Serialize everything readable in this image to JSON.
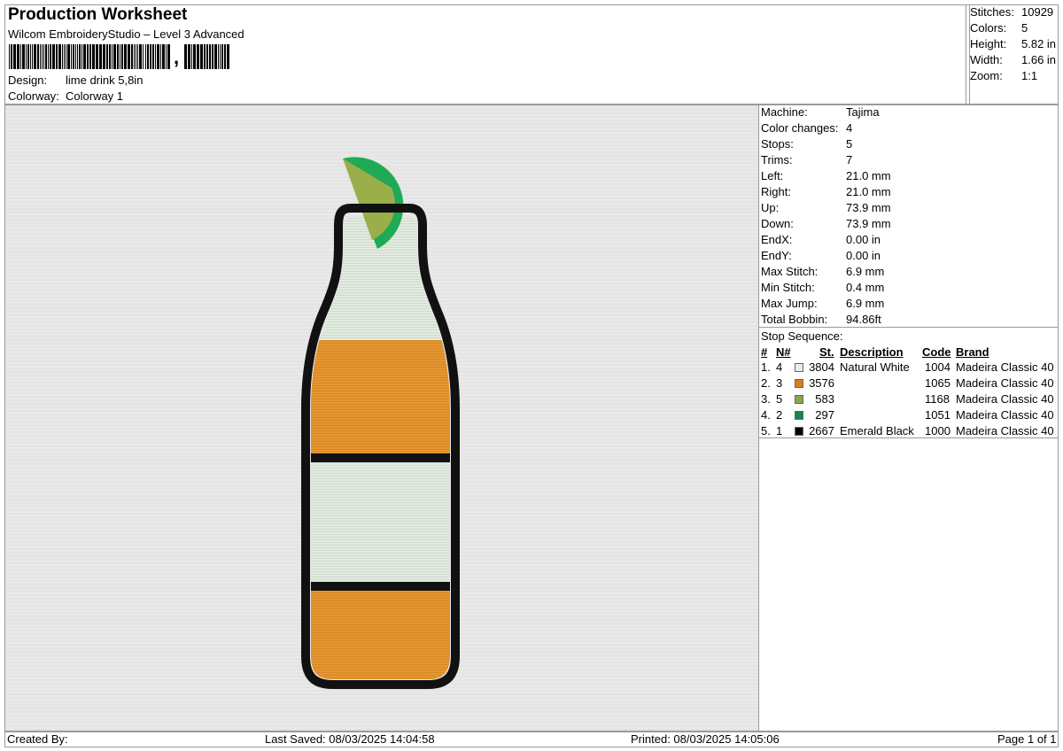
{
  "header": {
    "title": "Production Worksheet",
    "subtitle": "Wilcom EmbroideryStudio – Level 3 Advanced",
    "barcode_suffix": ",",
    "design_label": "Design:",
    "design_value": "lime drink 5,8in",
    "colorway_label": "Colorway:",
    "colorway_value": "Colorway 1"
  },
  "summary": [
    {
      "label": "Stitches:",
      "value": "10929"
    },
    {
      "label": "Colors:",
      "value": "5"
    },
    {
      "label": "Height:",
      "value": "5.82 in"
    },
    {
      "label": "Width:",
      "value": "1.66 in"
    },
    {
      "label": "Zoom:",
      "value": "1:1"
    }
  ],
  "info": [
    {
      "label": "Machine:",
      "value": "Tajima"
    },
    {
      "label": "Color changes:",
      "value": "4"
    },
    {
      "label": "Stops:",
      "value": "5"
    },
    {
      "label": "Trims:",
      "value": "7"
    },
    {
      "label": "Left:",
      "value": "21.0 mm"
    },
    {
      "label": "Right:",
      "value": "21.0 mm"
    },
    {
      "label": "Up:",
      "value": "73.9 mm"
    },
    {
      "label": "Down:",
      "value": "73.9 mm"
    },
    {
      "label": "EndX:",
      "value": "0.00 in"
    },
    {
      "label": "EndY:",
      "value": "0.00 in"
    },
    {
      "label": "Max Stitch:",
      "value": "6.9 mm"
    },
    {
      "label": "Min Stitch:",
      "value": "0.4 mm"
    },
    {
      "label": "Max Jump:",
      "value": "6.9 mm"
    },
    {
      "label": "Total Bobbin:",
      "value": "94.86ft"
    }
  ],
  "stop_sequence": {
    "title": "Stop Sequence:",
    "headers": {
      "num": "#",
      "n": "N#",
      "st": "St.",
      "desc": "Description",
      "code": "Code",
      "brand": "Brand"
    },
    "rows": [
      {
        "num": "1.",
        "n": "4",
        "color": "#e8ecef",
        "st": "3804",
        "desc": "Natural White",
        "code": "1004",
        "brand": "Madeira Classic 40"
      },
      {
        "num": "2.",
        "n": "3",
        "color": "#e07a1a",
        "st": "3576",
        "desc": "",
        "code": "1065",
        "brand": "Madeira Classic 40"
      },
      {
        "num": "3.",
        "n": "5",
        "color": "#8aa84a",
        "st": "583",
        "desc": "",
        "code": "1168",
        "brand": "Madeira Classic 40"
      },
      {
        "num": "4.",
        "n": "2",
        "color": "#0f8a4a",
        "st": "297",
        "desc": "",
        "code": "1051",
        "brand": "Madeira Classic 40"
      },
      {
        "num": "5.",
        "n": "1",
        "color": "#000000",
        "st": "2667",
        "desc": "Emerald Black",
        "code": "1000",
        "brand": "Madeira Classic 40"
      }
    ]
  },
  "footer": {
    "created_by": "Created By:",
    "last_saved": "Last Saved: 08/03/2025 14:04:58",
    "printed": "Printed: 08/03/2025 14:05:06",
    "page": "Page 1 of 1"
  }
}
